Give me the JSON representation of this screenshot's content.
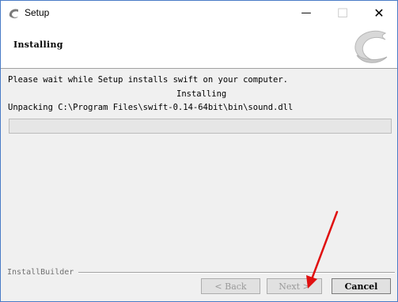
{
  "window": {
    "title": "Setup",
    "minimize_glyph": "—",
    "maximize_glyph": "☐",
    "close_glyph": "✕"
  },
  "header": {
    "title": "Installing",
    "logo_icon": "swift-bird-logo"
  },
  "body": {
    "wait_message": "Please wait while Setup installs swift on your computer.",
    "status": "Installing",
    "current_action": "Unpacking C:\\Program Files\\swift-0.14-64bit\\bin\\sound.dll",
    "progress": 0
  },
  "footer": {
    "brand": "InstallBuilder",
    "back_label": "< Back",
    "next_label": "Next >",
    "cancel_label": "Cancel"
  },
  "annotation": {
    "arrow_color": "#e01010",
    "arrow_target": "next-button"
  }
}
